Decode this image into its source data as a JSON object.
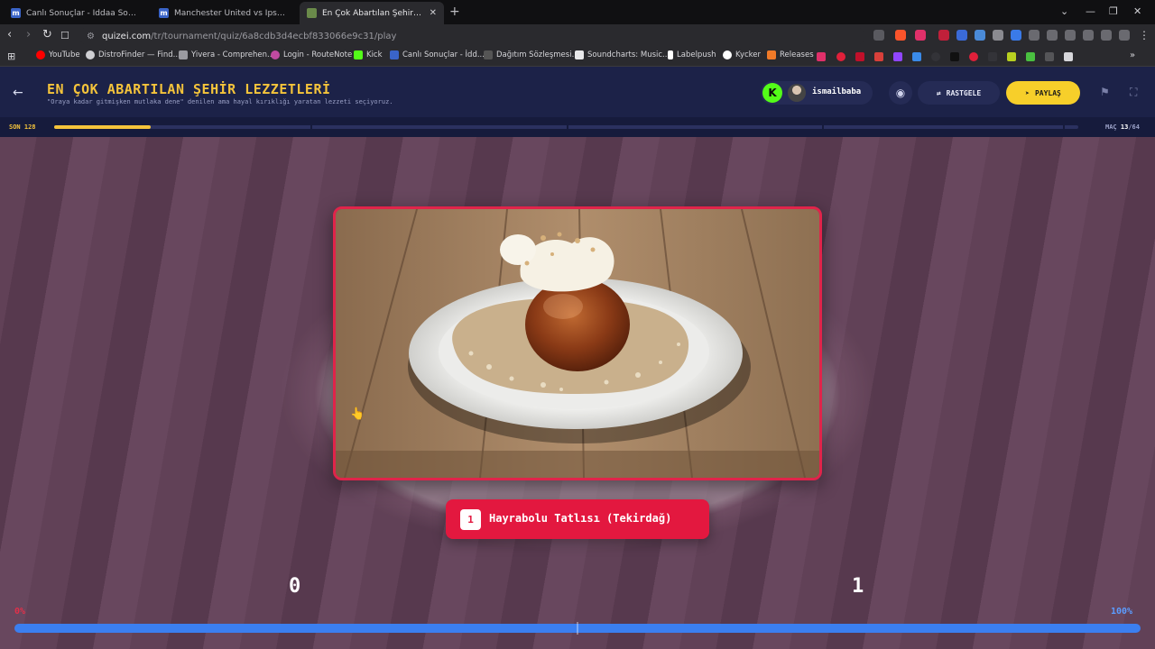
{
  "browser": {
    "tabs": [
      {
        "title": "Canlı Sonuçlar - İddaa Sonuçları | Ma",
        "favicon": "m"
      },
      {
        "title": "Manchester United vs Ipswich Town,",
        "favicon": "m"
      },
      {
        "title": "En Çok Abartılan Şehir Lezzetleri",
        "favicon": ""
      }
    ],
    "url_host": "quizei.com",
    "url_path": "/tr/tournament/quiz/6a8cdb3d4ecbf833066e9c31/play",
    "bookmarks": [
      {
        "label": "YouTube",
        "color": "#ff0000"
      },
      {
        "label": "DistroFinder — Find...",
        "color": "#cfcfd3"
      },
      {
        "label": "Yivera - Comprehen...",
        "color": "#cfcfd3"
      },
      {
        "label": "Login - RouteNote",
        "color": "#c04aa0"
      },
      {
        "label": "Kick",
        "color": "#53fc18"
      },
      {
        "label": "Canlı Sonuçlar - İdd...",
        "color": "#3a64c8"
      },
      {
        "label": "Dağıtım Sözleşmesi...",
        "color": "#555555"
      },
      {
        "label": "Soundcharts: Music...",
        "color": "#222222"
      },
      {
        "label": "Labelpush",
        "color": "#ffffff"
      },
      {
        "label": "Kycker",
        "color": "#ffffff"
      },
      {
        "label": "Releases",
        "color": "#f07a28"
      }
    ]
  },
  "header": {
    "title": "EN ÇOK ABARTILAN ŞEHİR LEZZETLERİ",
    "subtitle": "\"Oraya kadar gitmişken mutlaka dene\" denilen ama hayal kırıklığı yaratan lezzeti seçiyoruz.",
    "username": "ismailbaba",
    "kick_letter": "K",
    "random_label": "RASTGELE",
    "share_label": "PAYLAŞ"
  },
  "round": {
    "label": "SON 128",
    "progress": 0.094,
    "match_prefix": "MAÇ",
    "match_current": "13",
    "match_total": "/64"
  },
  "choice": {
    "number": "1",
    "label": "Hayrabolu Tatlısı (Tekirdağ)"
  },
  "votes": {
    "left_score": "0",
    "right_score": "1",
    "left_pct_label": "0%",
    "right_pct_label": "100%",
    "left_share": 0.0
  },
  "colors": {
    "accent_yellow": "#f5c43b",
    "choice_red": "#e3183f",
    "vote_blue": "#3b7ff0",
    "header_navy": "#1c2248"
  }
}
